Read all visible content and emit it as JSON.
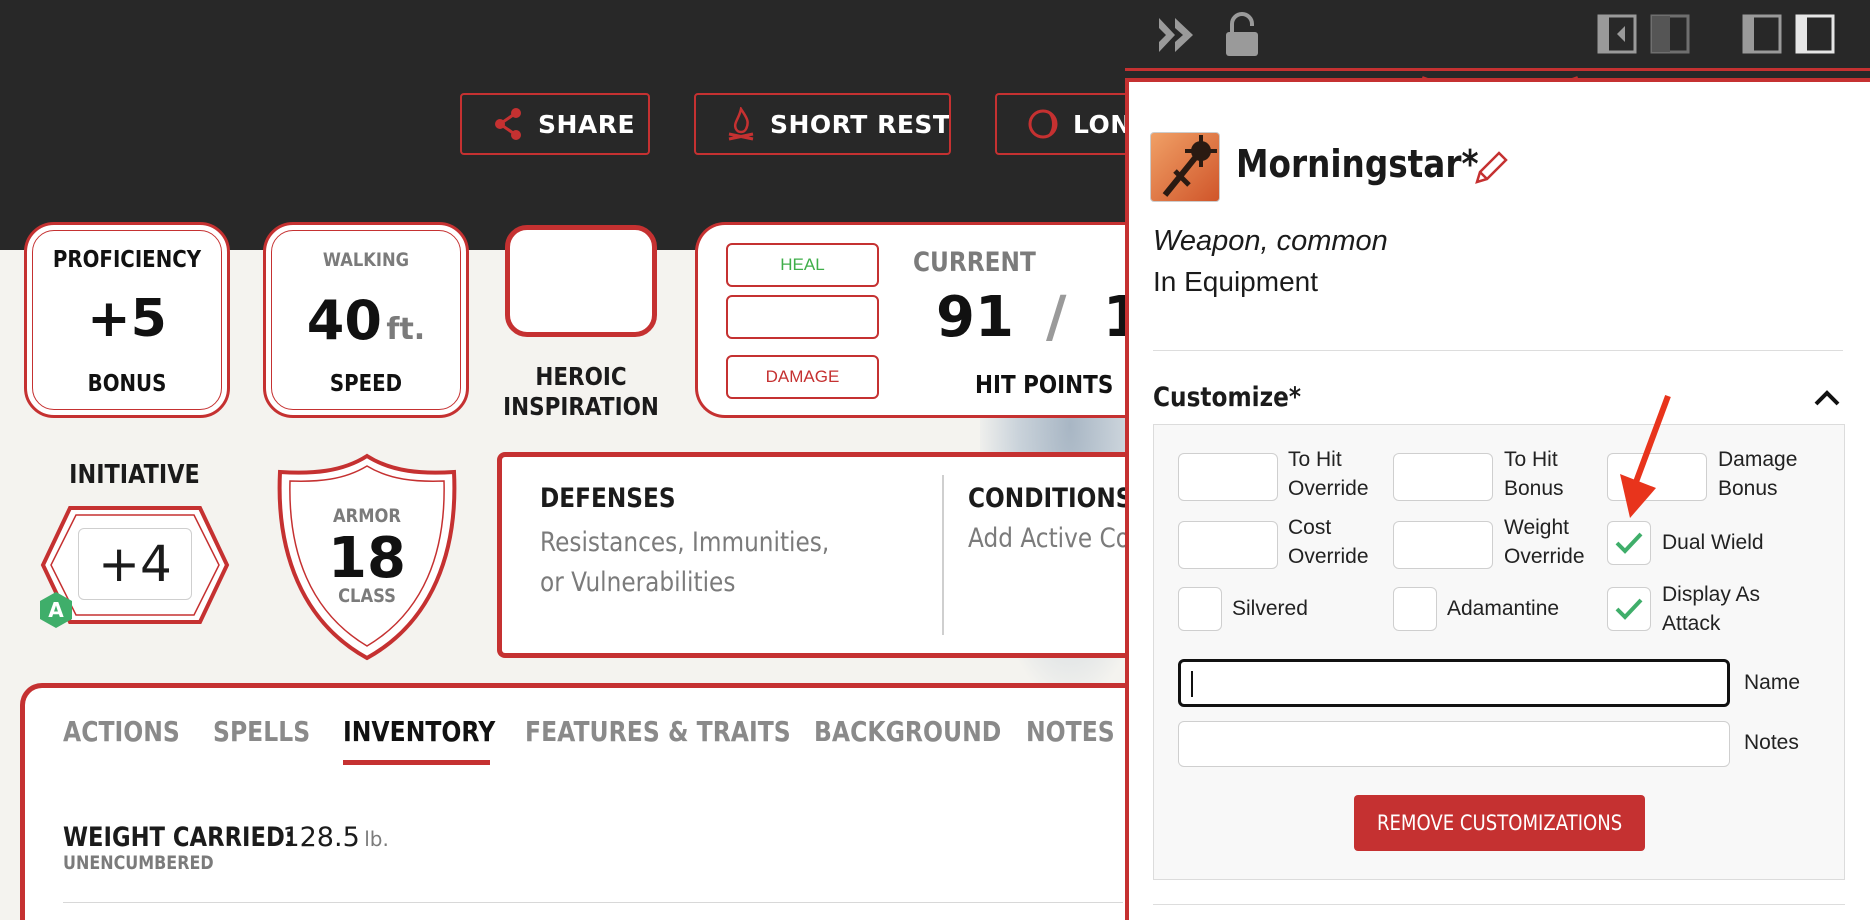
{
  "header": {
    "share_label": "SHARE",
    "short_rest_label": "SHORT REST",
    "long_rest_label": "LON"
  },
  "stats": {
    "proficiency": {
      "top": "PROFICIENCY",
      "value": "+5",
      "bottom": "BONUS"
    },
    "speed": {
      "top": "WALKING",
      "value": "40",
      "unit": "ft.",
      "bottom": "SPEED"
    },
    "heroic": {
      "line1": "HEROIC",
      "line2": "INSPIRATION"
    },
    "hit_points": {
      "heal_label": "HEAL",
      "damage_label": "DAMAGE",
      "current_label": "CURRENT",
      "current_value": "91",
      "separator": "/",
      "max_value_partial": "1",
      "bottom": "HIT POINTS"
    },
    "initiative": {
      "label": "INITIATIVE",
      "value": "+4",
      "badge": "A"
    },
    "armor": {
      "top": "ARMOR",
      "value": "18",
      "bottom": "CLASS"
    },
    "defenses": {
      "title": "DEFENSES",
      "text": "Resistances, Immunities, or Vulnerabilities"
    },
    "conditions": {
      "title": "CONDITIONS",
      "text": "Add Active Co"
    }
  },
  "tabs": [
    {
      "label": "ACTIONS",
      "active": false
    },
    {
      "label": "SPELLS",
      "active": false
    },
    {
      "label": "INVENTORY",
      "active": true
    },
    {
      "label": "FEATURES & TRAITS",
      "active": false
    },
    {
      "label": "BACKGROUND",
      "active": false
    },
    {
      "label": "NOTES",
      "active": false
    }
  ],
  "inventory": {
    "weight_label": "WEIGHT CARRIED:",
    "weight_value": "128.5",
    "weight_unit": "lb.",
    "encumbrance": "UNENCUMBERED"
  },
  "panel": {
    "item_name": "Morningstar*",
    "item_type": "Weapon, common",
    "item_location": "In Equipment",
    "customize_title": "Customize*",
    "fields": {
      "to_hit_override": "To Hit Override",
      "to_hit_bonus": "To Hit Bonus",
      "damage_bonus": "Damage Bonus",
      "cost_override": "Cost Override",
      "weight_override": "Weight Override",
      "dual_wield": "Dual Wield",
      "silvered": "Silvered",
      "adamantine": "Adamantine",
      "display_as_attack": "Display As Attack",
      "name": "Name",
      "notes": "Notes"
    },
    "checks": {
      "dual_wield": true,
      "silvered": false,
      "adamantine": false,
      "display_as_attack": true
    },
    "remove_button": "REMOVE CUSTOMIZATIONS"
  },
  "colors": {
    "accent": "#c53131",
    "header_bg": "#282828",
    "heal": "#3fae49",
    "check": "#3fae6a"
  }
}
